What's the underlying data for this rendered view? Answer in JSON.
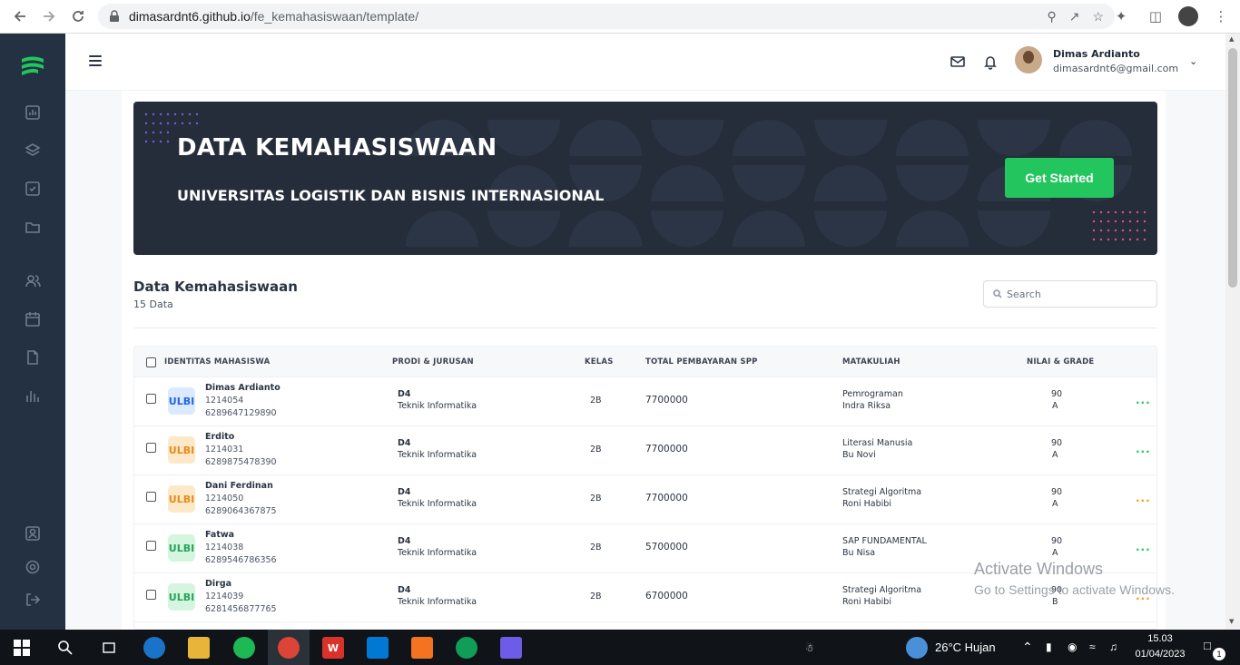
{
  "browser": {
    "url_host": "dimasardnt6.github.io",
    "url_path": "/fe_kemahasiswaan/template/"
  },
  "header": {
    "user_name": "Dimas Ardianto",
    "user_email": "dimasardnt6@gmail.com"
  },
  "banner": {
    "title": "DATA KEMAHASISWAAN",
    "subtitle": "UNIVERSITAS LOGISTIK DAN BISNIS INTERNASIONAL",
    "button_label": "Get Started",
    "button_color": "#22c55e"
  },
  "section": {
    "title": "Data Kemahasiswaan",
    "count": "15 Data",
    "search_placeholder": "Search"
  },
  "table": {
    "columns": [
      "IDENTITAS MAHASISWA",
      "PRODI & JURUSAN",
      "KELAS",
      "TOTAL PEMBAYARAN SPP",
      "MATAKULIAH",
      "NILAI & GRADE"
    ],
    "rows": [
      {
        "badge": "ULBI",
        "badge_color": "blue",
        "name": "Dimas Ardianto",
        "npm": "1214054",
        "phone": "6289647129890",
        "prodi": "D4",
        "jurusan": "Teknik Informatika",
        "kelas": "2B",
        "spp": "7700000",
        "matkul": "Pemrograman",
        "dosen": "Indra Riksa",
        "nilai": "90",
        "grade": "A",
        "dots_color": "#22c55e"
      },
      {
        "badge": "ULBI",
        "badge_color": "orange",
        "name": "Erdito",
        "npm": "1214031",
        "phone": "6289875478390",
        "prodi": "D4",
        "jurusan": "Teknik Informatika",
        "kelas": "2B",
        "spp": "7700000",
        "matkul": "Literasi Manusia",
        "dosen": "Bu Novi",
        "nilai": "90",
        "grade": "A",
        "dots_color": "#22c55e"
      },
      {
        "badge": "ULBI",
        "badge_color": "orange",
        "name": "Dani Ferdinan",
        "npm": "1214050",
        "phone": "6289064367875",
        "prodi": "D4",
        "jurusan": "Teknik Informatika",
        "kelas": "2B",
        "spp": "7700000",
        "matkul": "Strategi Algoritma",
        "dosen": "Roni Habibi",
        "nilai": "90",
        "grade": "A",
        "dots_color": "#f59e0b"
      },
      {
        "badge": "ULBI",
        "badge_color": "green",
        "name": "Fatwa",
        "npm": "1214038",
        "phone": "6289546786356",
        "prodi": "D4",
        "jurusan": "Teknik Informatika",
        "kelas": "2B",
        "spp": "5700000",
        "matkul": "SAP FUNDAMENTAL",
        "dosen": "Bu Nisa",
        "nilai": "90",
        "grade": "A",
        "dots_color": "#22c55e"
      },
      {
        "badge": "ULBI",
        "badge_color": "green",
        "name": "Dirga",
        "npm": "1214039",
        "phone": "6281456877765",
        "prodi": "D4",
        "jurusan": "Teknik Informatika",
        "kelas": "2B",
        "spp": "6700000",
        "matkul": "Strategi Algoritma",
        "dosen": "Roni Habibi",
        "nilai": "90",
        "grade": "B",
        "dots_color": "#f59e0b"
      }
    ]
  },
  "watermark": {
    "line1": "Activate Windows",
    "line2": "Go to Settings to activate Windows."
  },
  "taskbar": {
    "weather": "26°C  Hujan",
    "time": "15.03",
    "date": "01/04/2023",
    "notif_count": "1"
  }
}
